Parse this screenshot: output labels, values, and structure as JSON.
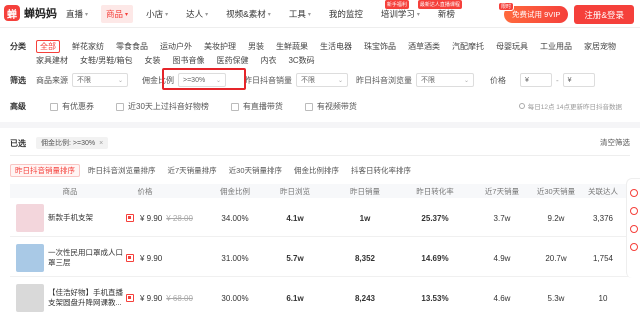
{
  "brand": {
    "name": "蝉妈妈",
    "logo_glyph": "蝉"
  },
  "nav": {
    "items": [
      {
        "label": "直播",
        "caret": "▾",
        "active": false
      },
      {
        "label": "商品",
        "caret": "▾",
        "active": true
      },
      {
        "label": "小店",
        "caret": "▾",
        "active": false
      },
      {
        "label": "达人",
        "caret": "▾",
        "active": false
      },
      {
        "label": "视频&素材",
        "caret": "▾",
        "active": false
      },
      {
        "label": "工具",
        "caret": "▾",
        "active": false
      },
      {
        "label": "我的监控",
        "caret": "",
        "active": false
      },
      {
        "label": "培训学习",
        "caret": "▾",
        "active": false
      },
      {
        "label": "新榜",
        "caret": "",
        "active": false
      }
    ],
    "badges": [
      "新手福利",
      "最新达人直播课程"
    ],
    "trial_tag": "限时",
    "trial_button": "免费试用 9VIP",
    "login_button": "注册&登录"
  },
  "filters": {
    "category_label": "分类",
    "categories_row1": [
      "全部",
      "鲜花家纺",
      "零食食品",
      "运动户外",
      "美妆护理",
      "男装",
      "生鲜蔬果",
      "生活电器",
      "珠宝饰品",
      "酒草酒类",
      "汽配摩托",
      "母婴玩具",
      "工业用品",
      "家居宠物"
    ],
    "categories_row2": [
      "家具建材",
      "女鞋/男鞋/箱包",
      "女装",
      "图书音像",
      "医药保健",
      "内衣",
      "3C数码"
    ],
    "screen_label": "筛选",
    "source_label": "商品来源",
    "source_value": "不限",
    "commission_label": "佣金比例",
    "commission_value": ">=30%",
    "yesterday_sales_label": "昨日抖音销量",
    "yesterday_sales_value": "不限",
    "yesterday_views_label": "昨日抖音浏览量",
    "yesterday_views_value": "不限",
    "price_label": "价格",
    "price_from_placeholder": "¥",
    "price_to_placeholder": "¥",
    "price_sep": "-",
    "advanced_label": "高级",
    "checks": [
      "有优惠券",
      "近30天上过抖音好物榜",
      "有直播带货",
      "有视频带货"
    ],
    "update_note": "每日12点 14点更新昨日抖音数据"
  },
  "selected": {
    "label": "已选",
    "chip": "佣金比例: >=30%",
    "chip_close": "×",
    "clear": "清空筛选"
  },
  "sort_tabs": [
    {
      "label": "昨日抖音销量排序",
      "active": true
    },
    {
      "label": "昨日抖音浏览量排序",
      "active": false
    },
    {
      "label": "近7天销量排序",
      "active": false
    },
    {
      "label": "近30天销量排序",
      "active": false
    },
    {
      "label": "佣金比例排序",
      "active": false
    },
    {
      "label": "抖客日转化率排序",
      "active": false
    }
  ],
  "table": {
    "headers": [
      "商品",
      "价格",
      "佣金比例",
      "昨日浏览",
      "昨日销量",
      "昨日转化率",
      "近7天销量",
      "近30天销量",
      "关联达人"
    ],
    "rows": [
      {
        "name": "新款手机支架",
        "price": "¥ 9.90",
        "old_price": "¥ 28.00",
        "commission": "34.00%",
        "views": "4.1w",
        "sales": "1w",
        "conversion": "25.37%",
        "sales7": "3.7w",
        "sales30": "9.2w",
        "creators": "3,376",
        "thumb_color": "#f3d6dc"
      },
      {
        "name": "一次性民用口罩成人口罩三层",
        "price": "¥ 9.90",
        "old_price": "",
        "commission": "31.00%",
        "views": "5.7w",
        "sales": "8,352",
        "conversion": "14.69%",
        "sales7": "4.9w",
        "sales30": "20.7w",
        "creators": "1,754",
        "thumb_color": "#a9c9e6"
      },
      {
        "name": "【佳浩好物】手机直播支架圆盘升降网课教...",
        "price": "¥ 9.90",
        "old_price": "¥ 68.00",
        "commission": "30.00%",
        "views": "6.1w",
        "sales": "8,243",
        "conversion": "13.53%",
        "sales7": "4.6w",
        "sales30": "5.3w",
        "creators": "10",
        "thumb_color": "#d9d9d9"
      }
    ]
  },
  "colors": {
    "accent": "#f5403b",
    "highlight": "#e5252a"
  }
}
